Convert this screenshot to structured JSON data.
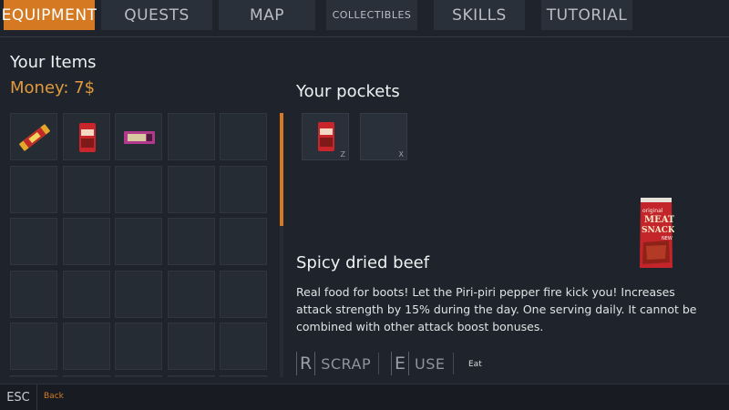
{
  "tabs": [
    {
      "label": "EQUIPMENT",
      "active": true
    },
    {
      "label": "QUESTS",
      "active": false
    },
    {
      "label": "MAP",
      "active": false
    },
    {
      "label": "COLLECTIBLES",
      "active": false
    },
    {
      "label": "SKILLS",
      "active": false
    },
    {
      "label": "TUTORIAL",
      "active": false
    }
  ],
  "inventory": {
    "title": "Your Items",
    "money": "Money: 7$",
    "items": [
      {
        "icon": "candy-bar-icon"
      },
      {
        "icon": "meat-snack-pack-icon"
      },
      {
        "icon": "chocolate-bar-icon"
      }
    ]
  },
  "pockets": {
    "title": "Your pockets",
    "slots": [
      {
        "key": "Z",
        "icon": "meat-snack-pack-icon"
      },
      {
        "key": "X",
        "icon": ""
      }
    ]
  },
  "selected_item": {
    "name": "Spicy dried beef",
    "description": "Real food for boots! Let the Piri-piri pepper fire kick you! Increases attack strength by 15% during the day. One serving daily. It cannot be combined with other attack boost bonuses.",
    "package_text": [
      "original",
      "MEAT",
      "SNACK",
      "NEW"
    ]
  },
  "actions": [
    {
      "key": "R",
      "label": "SCRAP"
    },
    {
      "key": "E",
      "label": "USE"
    }
  ],
  "action_hint": "Eat",
  "footer": {
    "key": "ESC",
    "label": "Back"
  },
  "colors": {
    "accent": "#d57a23",
    "money": "#e19a3c",
    "background": "#1f242c"
  }
}
